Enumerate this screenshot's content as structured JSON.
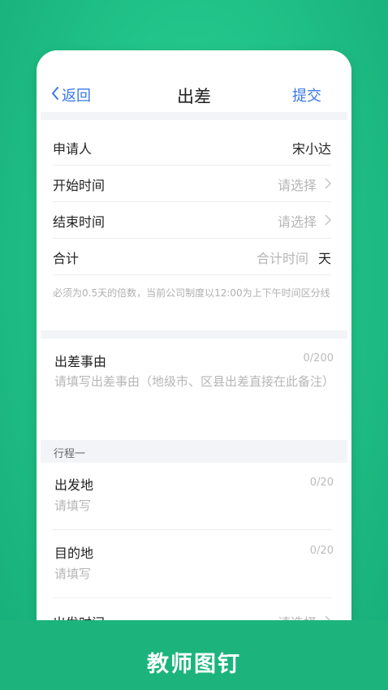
{
  "nav": {
    "back_label": "返回",
    "title": "出差",
    "submit_label": "提交"
  },
  "rows": {
    "applicant": {
      "label": "申请人",
      "value": "宋小达"
    },
    "start_time": {
      "label": "开始时间",
      "placeholder": "请选择"
    },
    "end_time": {
      "label": "结束时间",
      "placeholder": "请选择"
    },
    "total": {
      "label": "合计",
      "placeholder": "合计时间",
      "unit": "天"
    }
  },
  "note": "必须为0.5天的倍数，当前公司制度以12:00为上下午时间区分线",
  "reason": {
    "label": "出差事由",
    "count": "0/200",
    "placeholder": "请填写出差事由（地级市、区县出差直接在此备注）"
  },
  "itinerary": {
    "header": "行程一",
    "departure": {
      "label": "出发地",
      "count": "0/20",
      "placeholder": "请填写"
    },
    "destination": {
      "label": "目的地",
      "count": "0/20",
      "placeholder": "请填写"
    },
    "depart_time": {
      "label": "出发时间",
      "placeholder": "请选择"
    }
  },
  "brand": "教师图钉",
  "colors": {
    "accent": "#3b78e7",
    "background": "#1fbf86"
  }
}
